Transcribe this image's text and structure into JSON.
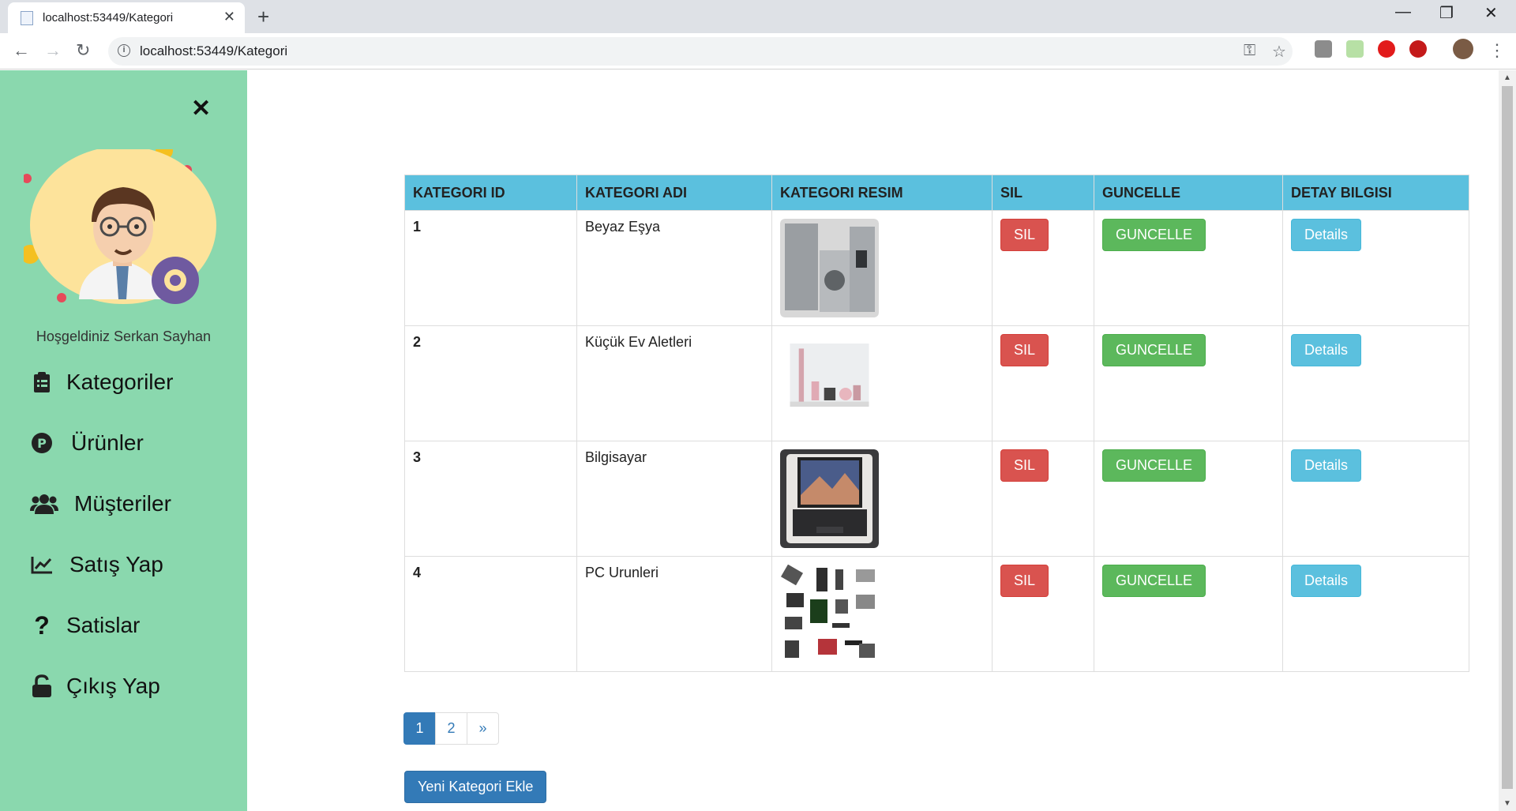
{
  "browser": {
    "tab_title": "localhost:53449/Kategori",
    "url": "localhost:53449/Kategori"
  },
  "sidebar": {
    "welcome": "Hoşgeldiniz Serkan Sayhan",
    "items": [
      {
        "label": "Kategoriler",
        "icon": "clipboard-list-icon"
      },
      {
        "label": "Ürünler",
        "icon": "product-p-icon"
      },
      {
        "label": "Müşteriler",
        "icon": "users-icon"
      },
      {
        "label": "Satış Yap",
        "icon": "chart-line-icon"
      },
      {
        "label": "Satislar",
        "icon": "question-icon"
      },
      {
        "label": "Çıkış Yap",
        "icon": "unlock-icon"
      }
    ]
  },
  "table": {
    "headers": [
      "KATEGORI ID",
      "KATEGORI ADI",
      "KATEGORI RESIM",
      "SIL",
      "GUNCELLE",
      "DETAY BILGISI"
    ],
    "rows": [
      {
        "id": "1",
        "name": "Beyaz Eşya",
        "image": "white-goods-image"
      },
      {
        "id": "2",
        "name": "Küçük Ev Aletleri",
        "image": "small-appliances-image"
      },
      {
        "id": "3",
        "name": "Bilgisayar",
        "image": "laptop-image"
      },
      {
        "id": "4",
        "name": "PC Urunleri",
        "image": "pc-parts-image"
      }
    ],
    "delete_label": "SIL",
    "update_label": "GUNCELLE",
    "details_label": "Details"
  },
  "pagination": {
    "pages": [
      "1",
      "2"
    ],
    "next": "»",
    "active": 1
  },
  "add_button": "Yeni Kategori Ekle",
  "colors": {
    "sidebar_bg": "#8ad8ae",
    "header_bg": "#5bc0de",
    "danger": "#d9534f",
    "success": "#5cb85c",
    "info": "#5bc0de",
    "primary": "#337ab7"
  }
}
